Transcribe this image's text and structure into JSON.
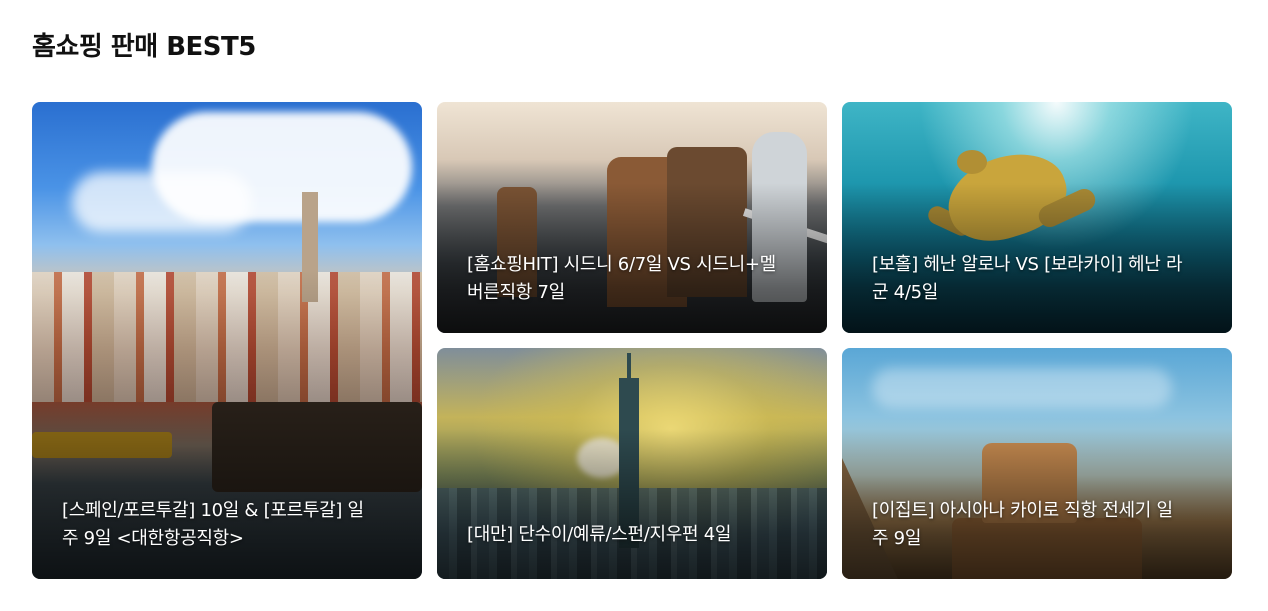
{
  "section": {
    "title": "홈쇼핑 판매 BEST5"
  },
  "cards": [
    {
      "caption_line1": "[스페인/포르투갈] 10일 & [포르투갈] 일",
      "caption_line2": "주 9일 <대한항공직항>",
      "image": "porto-riverside-town"
    },
    {
      "caption_line1": "[홈쇼핑HIT] 시드니 6/7일 VS 시드니+멜",
      "caption_line2": "버른직항 7일",
      "image": "twelve-apostles-coast"
    },
    {
      "caption_line1": "[보홀] 헤난 알로나 VS [보라카이] 헤난 라",
      "caption_line2": "군 4/5일",
      "image": "sea-turtle-underwater"
    },
    {
      "caption_line1": "[대만] 단수이/예류/스펀/지우펀 4일",
      "caption_line2": "",
      "image": "taipei-101-skyline"
    },
    {
      "caption_line1": "[이집트] 아시아나 카이로 직항 전세기 일",
      "caption_line2": "주 9일",
      "image": "sphinx-giza"
    }
  ]
}
